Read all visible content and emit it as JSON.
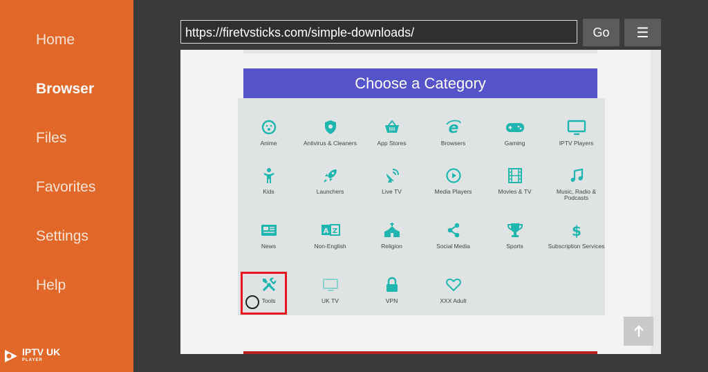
{
  "sidebar": {
    "items": [
      {
        "label": "Home",
        "active": false
      },
      {
        "label": "Browser",
        "active": true
      },
      {
        "label": "Files",
        "active": false
      },
      {
        "label": "Favorites",
        "active": false
      },
      {
        "label": "Settings",
        "active": false
      },
      {
        "label": "Help",
        "active": false
      }
    ],
    "logo": {
      "text": "IPTV UK",
      "sub": "PLAYER"
    }
  },
  "toolbar": {
    "url": "https://firetvsticks.com/simple-downloads/",
    "go_label": "Go",
    "menu_label": "☰"
  },
  "page": {
    "heading": "Choose a Category",
    "accent_color": "#1fb6b0",
    "header_color": "#5553c9",
    "highlight_color": "#e8141b",
    "categories": [
      {
        "label": "Anime",
        "icon": "smile-icon"
      },
      {
        "label": "Antivirus & Cleaners",
        "icon": "shield-icon"
      },
      {
        "label": "App Stores",
        "icon": "basket-icon"
      },
      {
        "label": "Browsers",
        "icon": "internet-explorer-icon"
      },
      {
        "label": "Gaming",
        "icon": "gamepad-icon"
      },
      {
        "label": "IPTV Players",
        "icon": "monitor-icon"
      },
      {
        "label": "Kids",
        "icon": "child-icon"
      },
      {
        "label": "Launchers",
        "icon": "rocket-icon"
      },
      {
        "label": "Live TV",
        "icon": "satellite-icon"
      },
      {
        "label": "Media Players",
        "icon": "play-circle-icon"
      },
      {
        "label": "Movies & TV",
        "icon": "film-icon"
      },
      {
        "label": "Music, Radio & Podcasts",
        "icon": "music-note-icon"
      },
      {
        "label": "News",
        "icon": "newspaper-icon"
      },
      {
        "label": "Non-English",
        "icon": "language-icon"
      },
      {
        "label": "Religion",
        "icon": "church-icon"
      },
      {
        "label": "Social Media",
        "icon": "share-icon"
      },
      {
        "label": "Sports",
        "icon": "trophy-icon"
      },
      {
        "label": "Subscription Services",
        "icon": "dollar-icon"
      },
      {
        "label": "Tools",
        "icon": "tools-icon"
      },
      {
        "label": "UK TV",
        "icon": "tv-icon"
      },
      {
        "label": "VPN",
        "icon": "lock-icon"
      },
      {
        "label": "XXX Adult",
        "icon": "heart-icon"
      }
    ]
  }
}
